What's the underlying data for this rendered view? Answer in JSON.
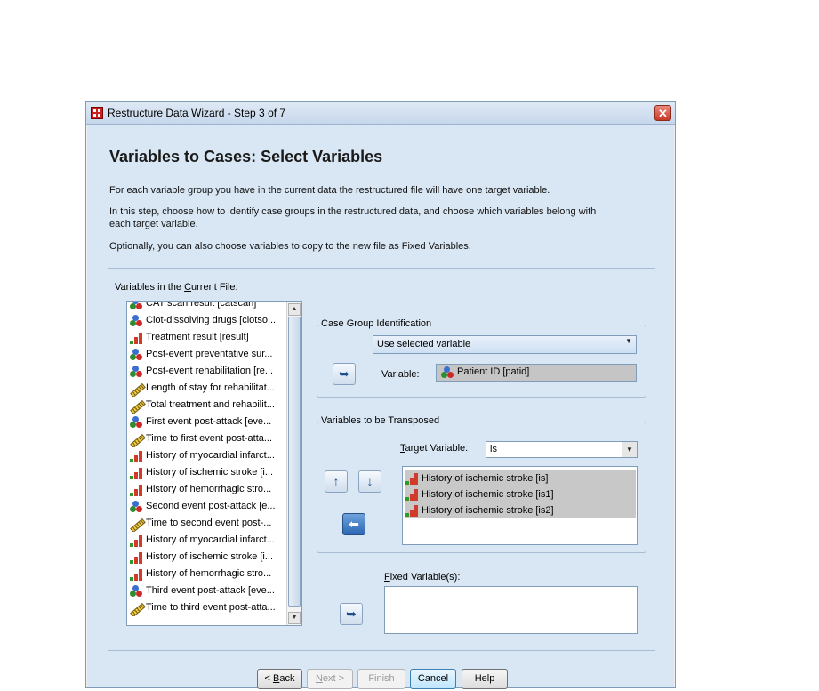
{
  "window": {
    "title": "Restructure Data Wizard - Step 3 of 7",
    "close_glyph": "✕"
  },
  "heading": "Variables to Cases: Select Variables",
  "intro": {
    "p1": "For each variable group you have in the current data the restructured file will have one target variable.",
    "p2_line1": "In this step, choose how to identify case groups in the restructured data, and choose which variables belong with",
    "p2_line2": "each target variable.",
    "p3": "Optionally, you can also choose variables to copy to the new file as Fixed Variables."
  },
  "source": {
    "label_pre": "Variables in the ",
    "label_key": "C",
    "label_post": "urrent File:",
    "items": [
      {
        "icon": "nominal",
        "label": "CAT scan result [catscan]"
      },
      {
        "icon": "nominal",
        "label": "Clot-dissolving drugs [clotso..."
      },
      {
        "icon": "ordinal",
        "label": "Treatment result [result]"
      },
      {
        "icon": "nominal",
        "label": "Post-event preventative sur..."
      },
      {
        "icon": "nominal",
        "label": "Post-event rehabilitation [re..."
      },
      {
        "icon": "scale",
        "label": "Length of stay for rehabilitat..."
      },
      {
        "icon": "scale",
        "label": "Total treatment and rehabilit..."
      },
      {
        "icon": "nominal",
        "label": "First event post-attack [eve..."
      },
      {
        "icon": "scale",
        "label": "Time to first event post-atta..."
      },
      {
        "icon": "ordinal",
        "label": "History of myocardial infarct..."
      },
      {
        "icon": "ordinal",
        "label": "History of ischemic stroke [i..."
      },
      {
        "icon": "ordinal",
        "label": "History of hemorrhagic stro..."
      },
      {
        "icon": "nominal",
        "label": "Second event post-attack [e..."
      },
      {
        "icon": "scale",
        "label": "Time to second event post-..."
      },
      {
        "icon": "ordinal",
        "label": "History of myocardial infarct..."
      },
      {
        "icon": "ordinal",
        "label": "History of ischemic stroke [i..."
      },
      {
        "icon": "ordinal",
        "label": "History of hemorrhagic stro..."
      },
      {
        "icon": "nominal",
        "label": "Third event post-attack [eve..."
      },
      {
        "icon": "scale",
        "label": "Time to third event post-atta..."
      }
    ]
  },
  "case_group": {
    "legend": "Case Group Identification",
    "method": "Use selected variable",
    "variable_label": "Variable:",
    "variable_value": "Patient ID [patid]"
  },
  "transposed": {
    "legend": "Variables to be Transposed",
    "target_label_key": "T",
    "target_label_rest": "arget Variable:",
    "target_value": "is",
    "items": [
      "History of ischemic stroke [is]",
      "History of ischemic stroke [is1]",
      "History of ischemic stroke [is2]"
    ]
  },
  "fixed": {
    "label_key": "F",
    "label_rest": "ixed Variable(s):"
  },
  "buttons": {
    "back_prefix": "< ",
    "back_key": "B",
    "back_rest": "ack",
    "next_key": "N",
    "next_rest": "ext >",
    "finish": "Finish",
    "cancel": "Cancel",
    "help": "Help"
  },
  "arrows": {
    "move": "➥",
    "up": "🡑",
    "down": "🡓",
    "up_plain": "↑",
    "down_plain": "↓",
    "left_in": "↩"
  }
}
